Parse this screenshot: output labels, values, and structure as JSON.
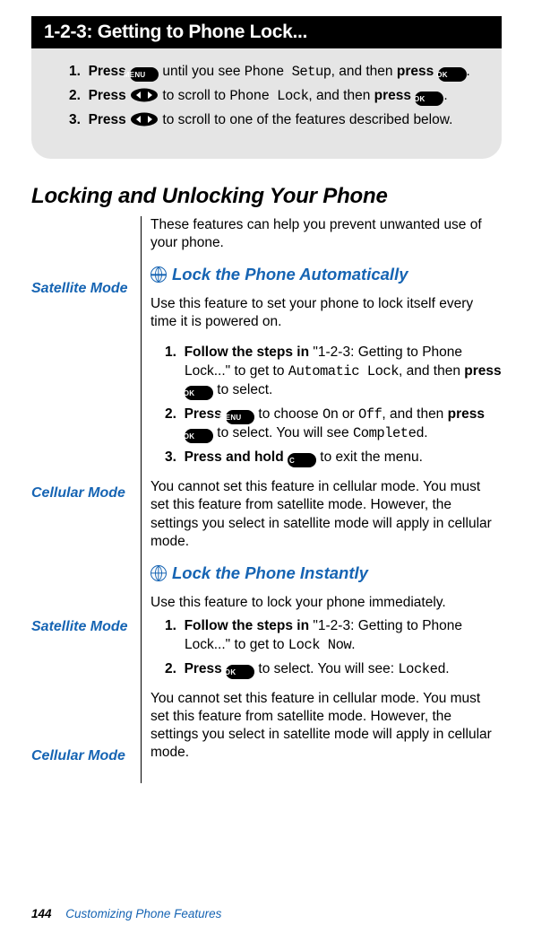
{
  "box": {
    "title": "1-2-3: Getting to Phone Lock...",
    "steps": [
      {
        "n": "1.",
        "before": "Press ",
        "icon": "menu",
        "mid1": " until you see ",
        "menu": "Phone Setup",
        "mid2": ", and then ",
        "bold2": "press ",
        "icon2": "ok",
        "after": "."
      },
      {
        "n": "2.",
        "before": "Press ",
        "icon": "scroll",
        "mid1": " to scroll to ",
        "menu": "Phone Lock",
        "mid2": ", and then ",
        "bold2": "press ",
        "icon2": "ok",
        "after": "."
      },
      {
        "n": "3.",
        "before": "Press ",
        "icon": "scroll",
        "mid1": " to scroll to one of the features described below.",
        "menu": "",
        "mid2": "",
        "bold2": "",
        "icon2": "",
        "after": ""
      }
    ]
  },
  "section_title": "Locking and Unlocking Your Phone",
  "intro": "These features can help you prevent unwanted use of your phone.",
  "sub1": {
    "title": "Lock the Phone Automatically",
    "sat_label": "Satellite Mode",
    "sat_body": "Use this feature to set your phone to lock itself every time it is powered on.",
    "steps": [
      {
        "n": "1.",
        "bold": "Follow the steps in ",
        "plain1": "\"1-2-3: Getting to Phone Lock...\" to get to ",
        "menu": "Automatic Lock",
        "plain2": ", and then ",
        "bold2": "press ",
        "icon": "ok",
        "after": " to select."
      },
      {
        "n": "2.",
        "bold": "Press ",
        "icon_pre": "menu",
        "plain1": " to choose ",
        "menu": "On",
        "plain_or": " or ",
        "menu2": "Off",
        "plain2": ", and then ",
        "bold2": "press ",
        "icon": "ok",
        "after": " to select. You will see ",
        "menu3": "Completed",
        "tail": "."
      },
      {
        "n": "3.",
        "bold": "Press and hold ",
        "icon_pre": "c",
        "plain1": " to exit the menu."
      }
    ],
    "cell_label": "Cellular Mode",
    "cell_body": "You cannot set this feature in cellular mode. You must set this feature from satellite mode. However, the settings you select in satellite mode will apply in cellular mode."
  },
  "sub2": {
    "title": "Lock the Phone Instantly",
    "sat_label": "Satellite Mode",
    "sat_body": "Use this feature to lock your phone immediately.",
    "steps": [
      {
        "n": "1.",
        "bold": "Follow the steps in ",
        "plain1": "\"1-2-3: Getting to Phone Lock...\" to get to ",
        "menu": "Lock Now",
        "tail": "."
      },
      {
        "n": "2.",
        "bold": "Press ",
        "icon_pre": "ok",
        "plain1": " to select. You will see: ",
        "menu": "Locked",
        "tail": "."
      }
    ],
    "cell_label": "Cellular Mode",
    "cell_body": "You cannot set this feature in cellular mode. You must set this feature from satellite mode. However, the settings you select in satellite mode will apply in cellular mode."
  },
  "footer": {
    "page": "144",
    "chapter": "Customizing Phone Features"
  },
  "icons": {
    "menu": "MENU",
    "ok": "OK",
    "c": "C"
  }
}
